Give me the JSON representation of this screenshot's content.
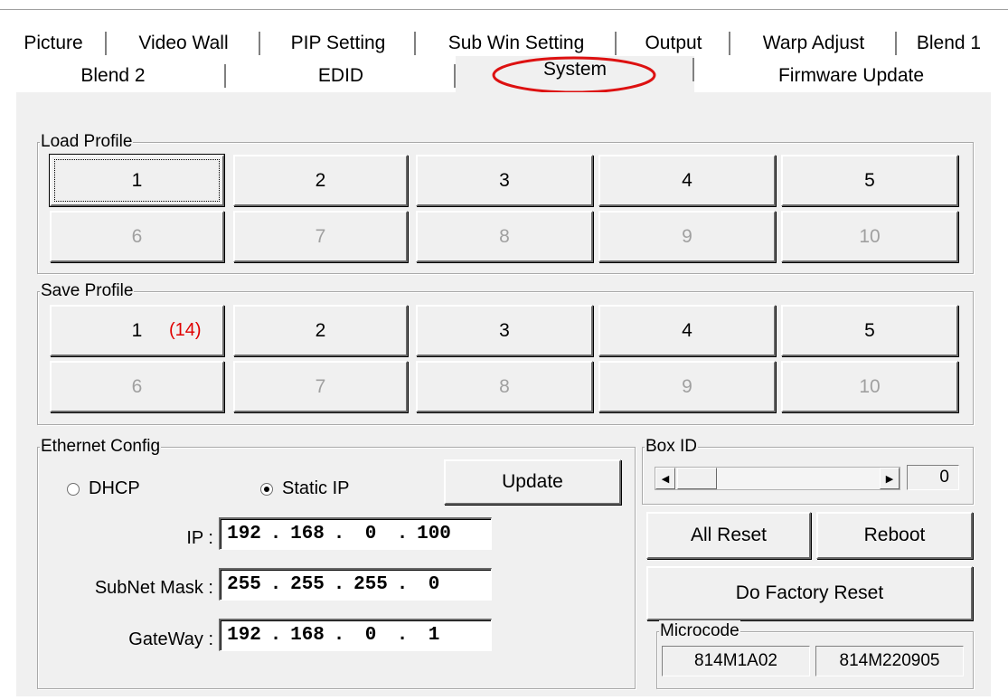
{
  "tabs_row1": [
    "Picture",
    "Video Wall",
    "PIP Setting",
    "Sub Win Setting",
    "Output",
    "Warp Adjust",
    "Blend 1"
  ],
  "tabs_row2": [
    "Blend 2",
    "EDID",
    "System",
    "Firmware Update"
  ],
  "active_tab": "System",
  "load_profile": {
    "title": "Load Profile",
    "buttons": [
      "1",
      "2",
      "3",
      "4",
      "5",
      "6",
      "7",
      "8",
      "9",
      "10"
    ]
  },
  "save_profile": {
    "title": "Save Profile",
    "buttons": [
      "1",
      "2",
      "3",
      "4",
      "5",
      "6",
      "7",
      "8",
      "9",
      "10"
    ],
    "annotation": "(14)"
  },
  "ethernet": {
    "title": "Ethernet Config",
    "dhcp_label": "DHCP",
    "static_label": "Static IP",
    "mode": "Static IP",
    "update_label": "Update",
    "ip_label": "IP :",
    "ip": [
      "192",
      "168",
      "0",
      "100"
    ],
    "subnet_label": "SubNet Mask :",
    "subnet": [
      "255",
      "255",
      "255",
      "0"
    ],
    "gateway_label": "GateWay :",
    "gateway": [
      "192",
      "168",
      "0",
      "1"
    ],
    "dot": "."
  },
  "box_id": {
    "title": "Box ID",
    "value": "0"
  },
  "all_reset_label": "All Reset",
  "reboot_label": "Reboot",
  "factory_reset_label": "Do Factory Reset",
  "microcode": {
    "title": "Microcode",
    "value1": "814M1A02",
    "value2": "814M220905"
  },
  "colors": {
    "annotation_red": "#e00000",
    "panel_bg": "#f0f0f0"
  }
}
